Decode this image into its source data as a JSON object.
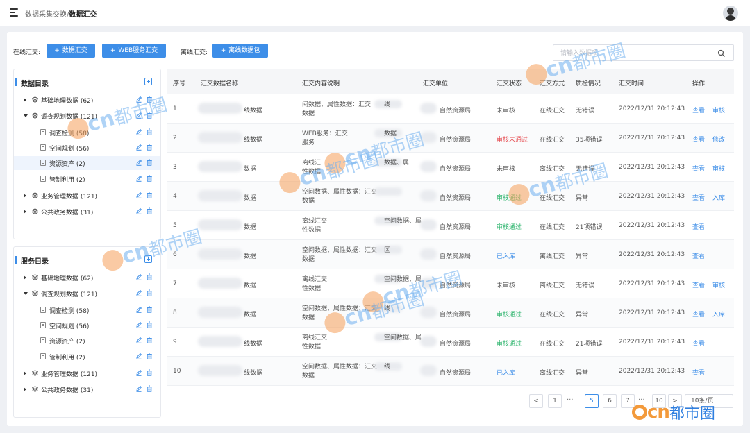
{
  "breadcrumb": {
    "parent": "数据采集交换/",
    "current": "数据汇交"
  },
  "toolbar": {
    "online_label": "在线汇交:",
    "btn_data": "数据汇交",
    "btn_web": "WEB服务汇交",
    "offline_label": "离线汇交:",
    "btn_offline": "离线数据包",
    "search_placeholder": "请输入数据项"
  },
  "data_catalog": {
    "title": "数据目录",
    "items": [
      {
        "label": "基础地理数据 (62)",
        "level": 1,
        "expanded": false
      },
      {
        "label": "调查规划数据 (121)",
        "level": 1,
        "expanded": true
      },
      {
        "label": "调查检测 (58)",
        "level": 2
      },
      {
        "label": "空间规划 (56)",
        "level": 2
      },
      {
        "label": "资源资产 (2)",
        "level": 2,
        "selected": true
      },
      {
        "label": "管制利用 (2)",
        "level": 2
      },
      {
        "label": "业务管理数据 (121)",
        "level": 1,
        "expanded": false
      },
      {
        "label": "公共政务数据 (31)",
        "level": 1,
        "expanded": false
      }
    ]
  },
  "service_catalog": {
    "title": "服务目录",
    "items": [
      {
        "label": "基础地理数据 (62)",
        "level": 1,
        "expanded": false
      },
      {
        "label": "调查规划数据 (121)",
        "level": 1,
        "expanded": true
      },
      {
        "label": "调查检测 (58)",
        "level": 2
      },
      {
        "label": "空间规划 (56)",
        "level": 2
      },
      {
        "label": "资源资产 (2)",
        "level": 2
      },
      {
        "label": "管制利用 (2)",
        "level": 2
      },
      {
        "label": "业务管理数据 (121)",
        "level": 1,
        "expanded": false
      },
      {
        "label": "公共政务数据 (31)",
        "level": 1,
        "expanded": false
      }
    ]
  },
  "table": {
    "headers": [
      "序号",
      "汇交数据名称",
      "汇交内容说明",
      "汇交单位",
      "汇交状态",
      "汇交方式",
      "质检情况",
      "汇交时间",
      "操作"
    ],
    "rows": [
      {
        "no": "1",
        "name": "线数据",
        "desc": [
          "间数据、属性数据：汇交",
          "数据"
        ],
        "desc_tail": "线",
        "unit": "自然资源局",
        "status": "未审核",
        "status_type": "none",
        "method": "在线汇交",
        "qc": "无错误",
        "time": "2022/12/31 20:12:43",
        "actions": [
          "查看",
          "审核"
        ]
      },
      {
        "no": "2",
        "name": "线数据",
        "desc": [
          "WEB服务：汇交",
          "服务"
        ],
        "desc_tail": "数据",
        "unit": "自然资源局",
        "status": "审核未通过",
        "status_type": "red",
        "method": "在线汇交",
        "qc": "35项错误",
        "time": "2022/12/31 20:12:43",
        "actions": [
          "查看",
          "修改"
        ]
      },
      {
        "no": "3",
        "name": "数据",
        "desc": [
          "离线汇",
          "性数据"
        ],
        "desc_tail": "数据、属",
        "unit": "自然资源局",
        "status": "未审核",
        "status_type": "none",
        "method": "离线汇交",
        "qc": "无错误",
        "time": "2022/12/31 20:12:43",
        "actions": [
          "查看",
          "审核"
        ]
      },
      {
        "no": "4",
        "name": "数据",
        "desc": [
          "空间数据、属性数据：汇交",
          "数据"
        ],
        "desc_tail": "",
        "unit": "自然资源局",
        "status": "审核通过",
        "status_type": "green",
        "method": "在线汇交",
        "qc": "异常",
        "time": "2022/12/31 20:12:43",
        "actions": [
          "查看",
          "入库"
        ]
      },
      {
        "no": "5",
        "name": "数据",
        "desc": [
          "离线汇交",
          "性数据"
        ],
        "desc_tail": "空间数据、属",
        "unit": "自然资源局",
        "status": "审核通过",
        "status_type": "green",
        "method": "在线汇交",
        "qc": "21项错误",
        "time": "2022/12/31 20:12:43",
        "actions": [
          "查看"
        ]
      },
      {
        "no": "6",
        "name": "数据",
        "desc": [
          "空间数据、属性数据：汇交",
          "数据"
        ],
        "desc_tail": "区",
        "unit": "自然资源局",
        "status": "已入库",
        "status_type": "blue",
        "method": "离线汇交",
        "qc": "异常",
        "time": "2022/12/31 20:12:43",
        "actions": [
          "查看"
        ]
      },
      {
        "no": "7",
        "name": "数据",
        "desc": [
          "离线汇交",
          "性数据"
        ],
        "desc_tail": "空间数据、属",
        "unit": "自然资源局",
        "status": "未审核",
        "status_type": "none",
        "method": "离线汇交",
        "qc": "无错误",
        "time": "2022/12/31 20:12:43",
        "actions": [
          "查看",
          "审核"
        ]
      },
      {
        "no": "8",
        "name": "数据",
        "desc": [
          "空间数据、属性数据：汇交",
          "数据"
        ],
        "desc_tail": "线",
        "unit": "自然资源局",
        "status": "审核通过",
        "status_type": "green",
        "method": "在线汇交",
        "qc": "异常",
        "time": "2022/12/31 20:12:43",
        "actions": [
          "查看",
          "入库"
        ]
      },
      {
        "no": "9",
        "name": "线数据",
        "desc": [
          "离线汇交",
          "性数据"
        ],
        "desc_tail": "空间数据、属",
        "unit": "自然资源局",
        "status": "审核通过",
        "status_type": "green",
        "method": "在线汇交",
        "qc": "21项错误",
        "time": "2022/12/31 20:12:43",
        "actions": [
          "查看"
        ]
      },
      {
        "no": "10",
        "name": "线数据",
        "desc": [
          "空间数据、属性数据：汇交",
          "数据"
        ],
        "desc_tail": "线",
        "unit": "自然资源局",
        "status": "已入库",
        "status_type": "blue",
        "method": "离线汇交",
        "qc": "异常",
        "time": "2022/12/31 20:12:43",
        "actions": [
          "查看"
        ]
      }
    ]
  },
  "pagination": {
    "prev": "<",
    "pages": [
      "1",
      "5",
      "6",
      "7",
      "10"
    ],
    "current": "5",
    "ellipsis": "···",
    "next": ">",
    "page_size": "10条/页"
  },
  "watermark": {
    "text": ".cn都市圈"
  },
  "colors": {
    "primary": "#3d8ee8",
    "danger": "#e5484d",
    "success": "#2db46d"
  }
}
